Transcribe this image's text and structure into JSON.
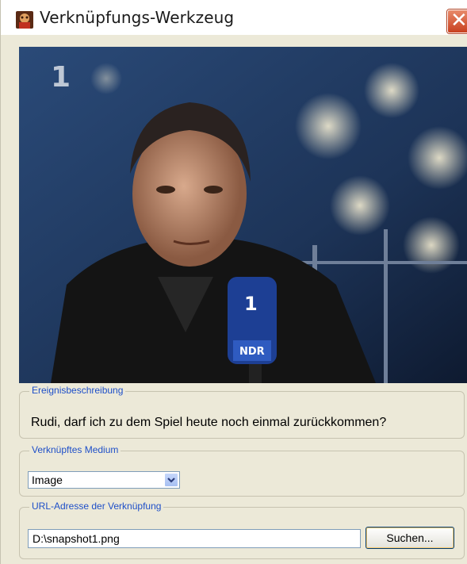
{
  "window": {
    "title": "Verknüpfungs-Werkzeug",
    "app_icon": "app-icon",
    "close_label": "✕"
  },
  "video": {
    "icon": "tv-frame-image"
  },
  "description_group": {
    "legend": "Ereignisbeschreibung",
    "text": "Rudi, darf ich zu dem Spiel heute noch einmal zurückkommen?"
  },
  "medium_group": {
    "legend": "Verknüpftes Medium",
    "selected": "Image"
  },
  "url_group": {
    "legend": "URL-Adresse der Verknüpfung",
    "value": "D:\\snapshot1.png",
    "browse_label": "Suchen..."
  },
  "colors": {
    "legend_text": "#1e4fc8",
    "window_bg": "#ece9d8",
    "close_button": "#c8401f"
  }
}
